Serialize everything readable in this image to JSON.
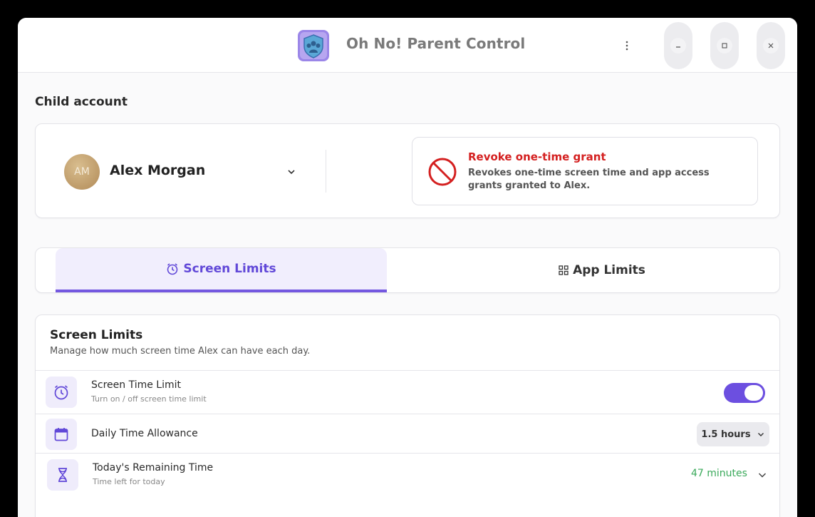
{
  "window": {
    "title": "Oh No! Parent Control",
    "controls": {
      "menu": "menu-icon",
      "minimize": "minimize-icon",
      "maximize": "maximize-icon",
      "close": "close-icon"
    }
  },
  "account_section": {
    "label": "Child account",
    "child": {
      "initials": "AM",
      "name": "Alex Morgan"
    },
    "revoke": {
      "title": "Revoke one-time grant",
      "description": "Revokes one-time screen time and app access grants granted to Alex."
    }
  },
  "tabs": [
    {
      "label": "Screen Limits",
      "icon": "alarm-clock-icon",
      "active": true
    },
    {
      "label": "App Limits",
      "icon": "grid-icon",
      "active": false
    }
  ],
  "screen_limits": {
    "title": "Screen Limits",
    "subtitle": "Manage how much screen time Alex can have each day.",
    "rows": [
      {
        "title": "Screen Time Limit",
        "subtitle": "Turn on / off screen time limit",
        "icon": "alarm-clock-icon",
        "toggle_on": true
      },
      {
        "title": "Daily Time Allowance",
        "icon": "calendar-icon",
        "value": "1.5 hours"
      },
      {
        "title": "Today's Remaining Time",
        "subtitle": "Time left for today",
        "icon": "hourglass-icon",
        "value": "47 minutes"
      }
    ]
  },
  "colors": {
    "accent": "#6c4fe0",
    "danger": "#d42020",
    "success": "#3aa95a"
  }
}
